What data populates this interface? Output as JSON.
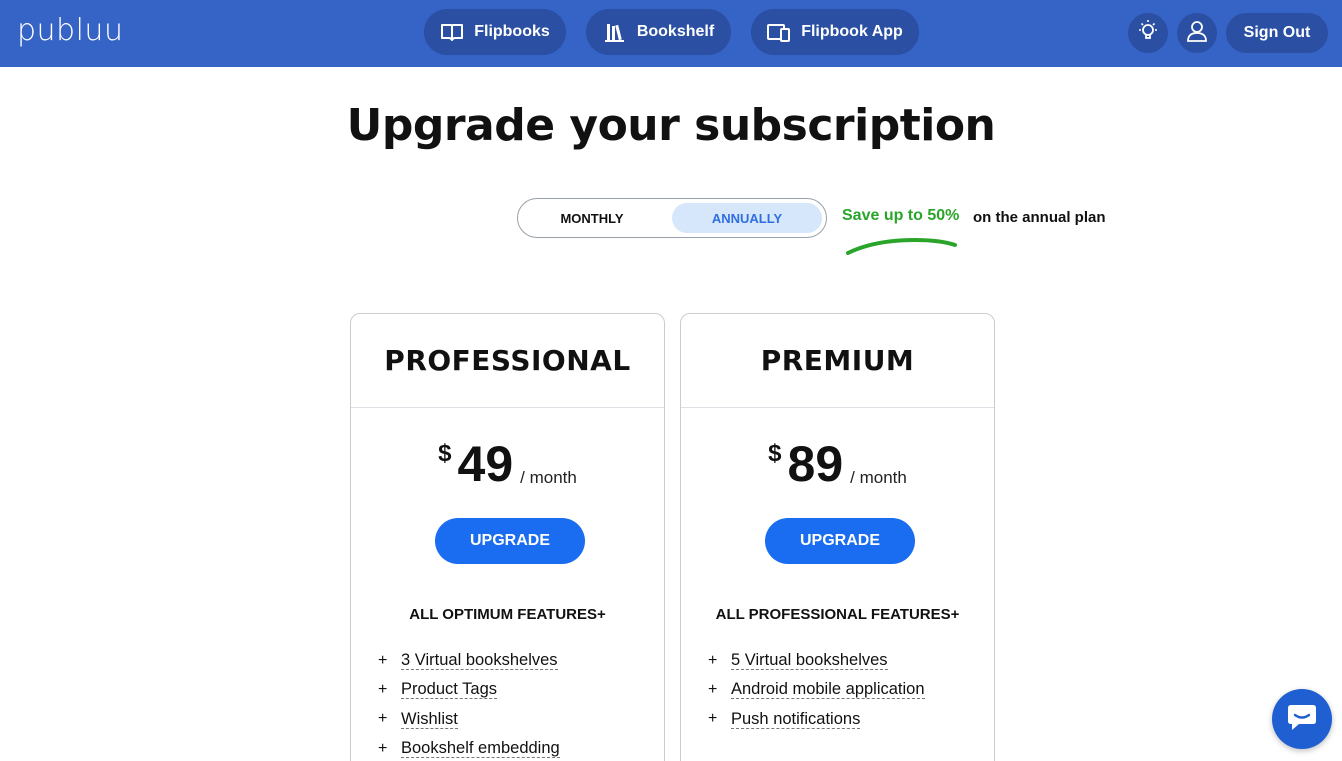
{
  "header": {
    "logo": "publuu",
    "nav": [
      {
        "label": "Flipbooks",
        "icon": "book-open-icon"
      },
      {
        "label": "Bookshelf",
        "icon": "books-icon"
      },
      {
        "label": "Flipbook App",
        "icon": "devices-icon"
      }
    ],
    "theme_icon": "lightbulb-icon",
    "account_icon": "user-icon",
    "signout_label": "Sign Out"
  },
  "page": {
    "title": "Upgrade your subscription"
  },
  "billing": {
    "options": [
      "MONTHLY",
      "ANNUALLY"
    ],
    "selected": "ANNUALLY",
    "save_highlight": "Save up to 50%",
    "save_rest": "on the annual plan"
  },
  "plans": [
    {
      "name": "PROFESSIONAL",
      "currency": "$",
      "price": "49",
      "period": "/ month",
      "button": "UPGRADE",
      "features_heading": "ALL OPTIMUM FEATURES+",
      "features": [
        "3 Virtual bookshelves",
        "Product Tags",
        "Wishlist",
        "Bookshelf embedding"
      ]
    },
    {
      "name": "PREMIUM",
      "currency": "$",
      "price": "89",
      "period": "/ month",
      "button": "UPGRADE",
      "features_heading": "ALL PROFESSIONAL FEATURES+",
      "features": [
        "5 Virtual bookshelves",
        "Android mobile application",
        "Push notifications"
      ]
    }
  ],
  "colors": {
    "header_bg": "#3663c6",
    "nav_pill": "#2a4fa3",
    "accent_button": "#1a6df0",
    "save_green": "#2aa52a",
    "toggle_selected_bg": "#d6e6fb",
    "toggle_selected_text": "#2f6fe0"
  },
  "chat": {
    "icon": "chat-bubble-icon"
  }
}
